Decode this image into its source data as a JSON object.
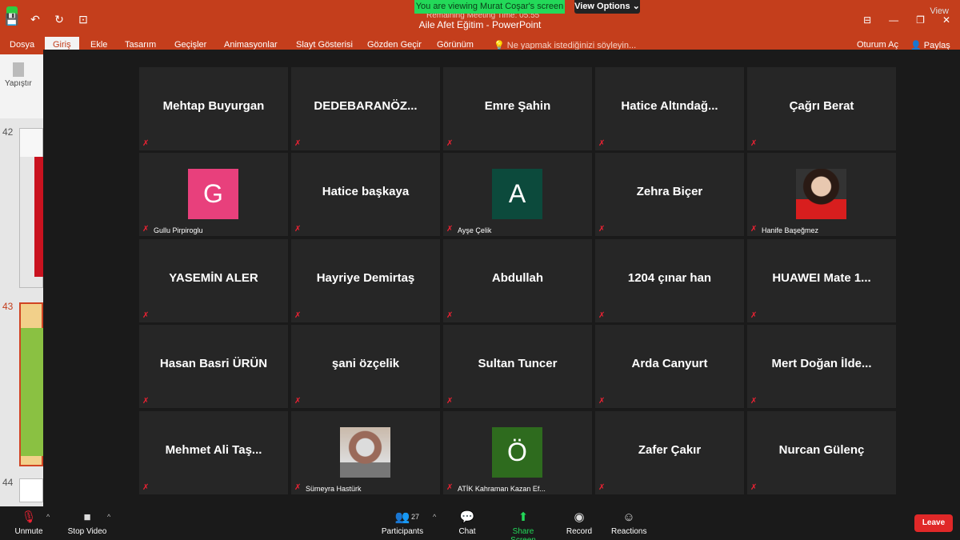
{
  "zoom_banner": {
    "sharing_text": "You are viewing Murat Coşar's screen",
    "view_options": "View Options ⌄",
    "remaining": "Remaining Meeting Time: 05:55",
    "view_label": "View"
  },
  "powerpoint": {
    "doc_title": "Aile Afet Eğitim - PowerPoint",
    "tabs": [
      "Dosya",
      "Giriş",
      "Ekle",
      "Tasarım",
      "Geçişler",
      "Animasyonlar",
      "Slayt Gösterisi",
      "Gözden Geçir",
      "Görünüm"
    ],
    "tell_me": "Ne yapmak istediğinizi söyleyin...",
    "sign_in": "Oturum Aç",
    "share": "Paylaş",
    "paste_label": "Yapıştır",
    "slide_numbers": [
      "42",
      "43",
      "44"
    ]
  },
  "gallery": {
    "tiles": [
      {
        "display": "Mehtap Buyurgan",
        "label": ""
      },
      {
        "display": "DEDEBARANÖZ...",
        "label": ""
      },
      {
        "display": "Emre Şahin",
        "label": ""
      },
      {
        "display": "Hatice  Altındağ...",
        "label": ""
      },
      {
        "display": "Çağrı Berat",
        "label": ""
      },
      {
        "display": "",
        "avatar": "G",
        "avatar_color": "#e8407c",
        "label": "Gullu Pirpiroglu"
      },
      {
        "display": "Hatice başkaya",
        "label": ""
      },
      {
        "display": "",
        "avatar": "A",
        "avatar_color": "#0c4a3c",
        "label": "Ayşe Çelik"
      },
      {
        "display": "Zehra Biçer",
        "label": ""
      },
      {
        "display": "",
        "photo": "woman-photo",
        "label": "Hanife Başeğmez"
      },
      {
        "display": "YASEMİN  ALER",
        "label": ""
      },
      {
        "display": "Hayriye Demirtaş",
        "label": ""
      },
      {
        "display": "Abdullah",
        "label": ""
      },
      {
        "display": "1204 çınar han",
        "label": ""
      },
      {
        "display": "HUAWEI  Mate  1...",
        "label": ""
      },
      {
        "display": "Hasan Basri ÜRÜN",
        "label": ""
      },
      {
        "display": "şani özçelik",
        "label": ""
      },
      {
        "display": "Sultan Tuncer",
        "label": ""
      },
      {
        "display": "Arda Canyurt",
        "label": ""
      },
      {
        "display": "Mert  Doğan  İlde...",
        "label": ""
      },
      {
        "display": "Mehmet  Ali  Taş...",
        "label": ""
      },
      {
        "display": "",
        "photo": "person-photo",
        "label": "Sümeyra Hastürk"
      },
      {
        "display": "",
        "avatar": "Ö",
        "avatar_color": "#2e6b1e",
        "label": "ATİK Kahraman Kazan Ef..."
      },
      {
        "display": "Zafer Çakır",
        "label": ""
      },
      {
        "display": "Nurcan Gülenç",
        "label": ""
      }
    ]
  },
  "toolbar": {
    "unmute": "Unmute",
    "stop_video": "Stop Video",
    "participants": "Participants",
    "participant_count": "27",
    "chat": "Chat",
    "share_screen": "Share Screen",
    "record": "Record",
    "reactions": "Reactions",
    "leave": "Leave"
  }
}
